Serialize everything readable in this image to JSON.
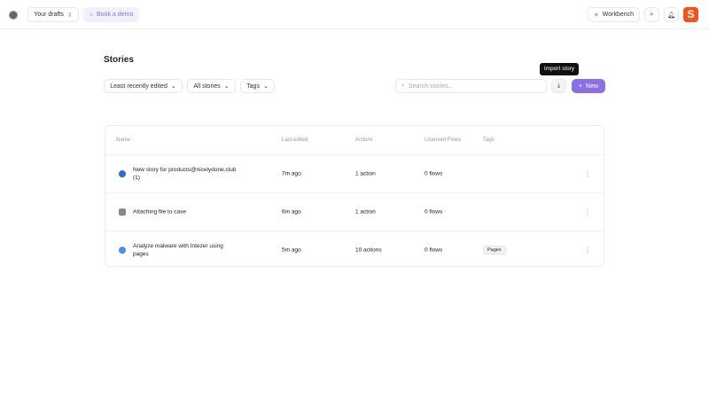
{
  "header": {
    "drafts": "Your drafts",
    "demo": "Book a demo",
    "workbench": "Workbench"
  },
  "page": {
    "title": "Stories",
    "sort": "Least recently edited",
    "filter": "All stories",
    "tags": "Tags",
    "search_placeholder": "Search stories...",
    "tooltip": "Import story",
    "new": "New"
  },
  "colors": {
    "accent": "#8b6fe6",
    "brand": "#f2541b"
  },
  "table": {
    "headers": [
      "Name",
      "Last edited",
      "Actions",
      "Licensed Flows",
      "Tags"
    ],
    "rows": [
      {
        "name": "New story for products@nicelydone.club (1)",
        "edited": "7m ago",
        "actions": "1 action",
        "flows": "0 flows",
        "tag": ""
      },
      {
        "name": "Attaching file to case",
        "edited": "6m ago",
        "actions": "1 action",
        "flows": "0 flows",
        "tag": ""
      },
      {
        "name": "Analyze malware with Intezer using pages",
        "edited": "5m ago",
        "actions": "10 actions",
        "flows": "0 flows",
        "tag": "Pages"
      }
    ]
  }
}
